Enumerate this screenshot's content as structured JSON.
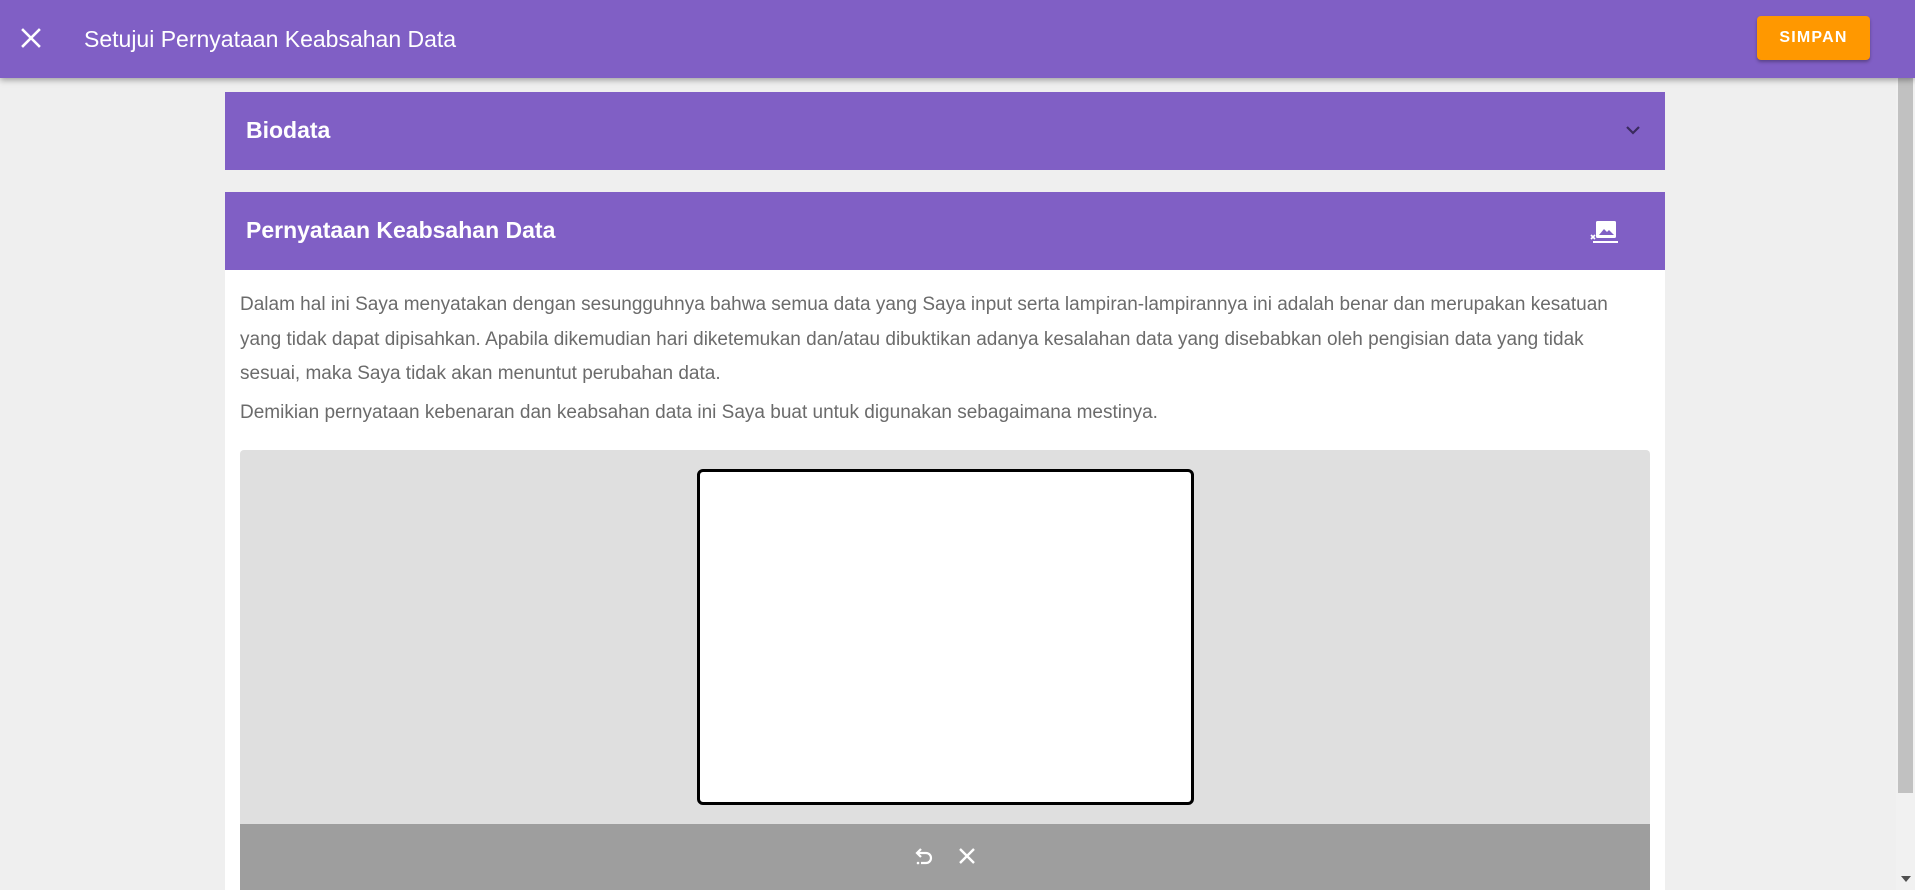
{
  "header": {
    "title": "Setujui Pernyataan Keabsahan Data",
    "save_label": "SIMPAN",
    "close_icon": "close-icon"
  },
  "panels": [
    {
      "title": "Biodata",
      "icon": "chevron-down-icon",
      "expanded": false
    },
    {
      "title": "Pernyataan Keabsahan Data",
      "icon": "image-clear-icon",
      "expanded": true
    }
  ],
  "statement": {
    "paragraph1": "Dalam hal ini Saya menyatakan dengan sesungguhnya bahwa semua data yang Saya input serta lampiran-lampirannya ini adalah benar dan merupakan kesatuan yang tidak dapat dipisahkan. Apabila dikemudian hari diketemukan dan/atau dibuktikan adanya kesalahan data yang disebabkan oleh pengisian data yang tidak sesuai, maka Saya tidak akan menuntut perubahan data.",
    "paragraph2": "Demikian pernyataan kebenaran dan keabsahan data ini Saya buat untuk digunakan sebagaimana mestinya."
  },
  "signature_pad": {
    "tools": [
      {
        "name": "undo",
        "icon": "undo-icon"
      },
      {
        "name": "clear",
        "icon": "close-icon"
      }
    ]
  },
  "colors": {
    "primary": "#805fc5",
    "accent": "#ff9800",
    "background": "#efefef",
    "toolbar": "#9e9e9e"
  }
}
